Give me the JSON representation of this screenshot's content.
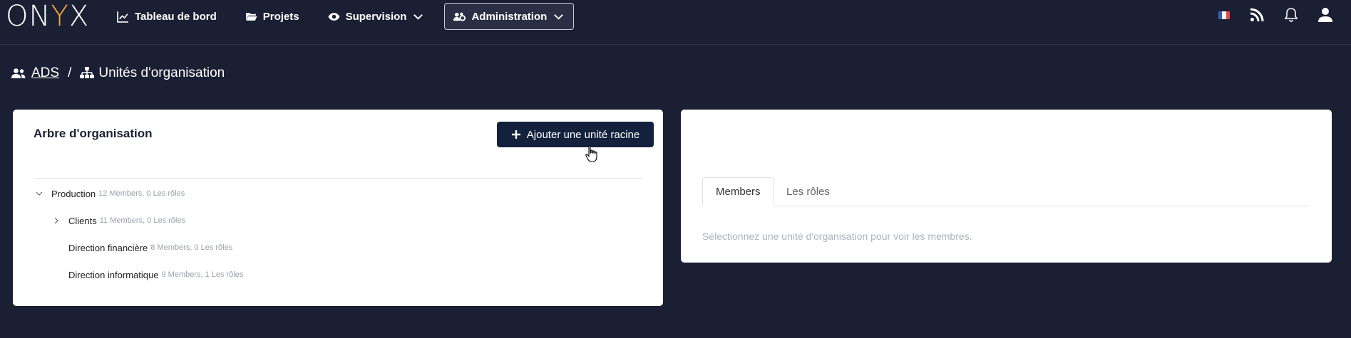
{
  "app": {
    "logo_text_left": "ON",
    "logo_text_accent": "Y",
    "logo_text_right": "X"
  },
  "nav": {
    "items": [
      {
        "label": "Tableau de bord",
        "icon": "chart-line-icon"
      },
      {
        "label": "Projets",
        "icon": "folder-open-icon"
      },
      {
        "label": "Supervision",
        "icon": "eye-icon",
        "dropdown": true
      },
      {
        "label": "Administration",
        "icon": "users-cog-icon",
        "dropdown": true,
        "active": true
      }
    ],
    "right_icons": [
      "flag-fr-icon",
      "rss-icon",
      "bell-icon",
      "user-icon"
    ]
  },
  "breadcrumb": {
    "root": "ADS",
    "separator": "/",
    "current": "Unités d'organisation"
  },
  "left_card": {
    "title": "Arbre d'organisation",
    "add_button": "Ajouter une unité racine",
    "tree": [
      {
        "name": "Production",
        "meta": "12 Members, 0 Les rôles",
        "level": 0,
        "expanded": true
      },
      {
        "name": "Clients",
        "meta": "11 Members, 0 Les rôles",
        "level": 1,
        "expanded": false
      },
      {
        "name": "Direction financière",
        "meta": "8 Members, 0 Les rôles",
        "level": 1
      },
      {
        "name": "Direction informatique",
        "meta": "9 Members, 1 Les rôles",
        "level": 1
      }
    ]
  },
  "right_card": {
    "tabs": [
      "Members",
      "Les rôles"
    ],
    "active_tab": "Members",
    "placeholder": "Sélectionnez une unité d'organisation pour voir les membres."
  },
  "colors": {
    "background": "#1b1f33",
    "button": "#14213d",
    "accent": "#f2a53a",
    "card": "#ffffff"
  }
}
